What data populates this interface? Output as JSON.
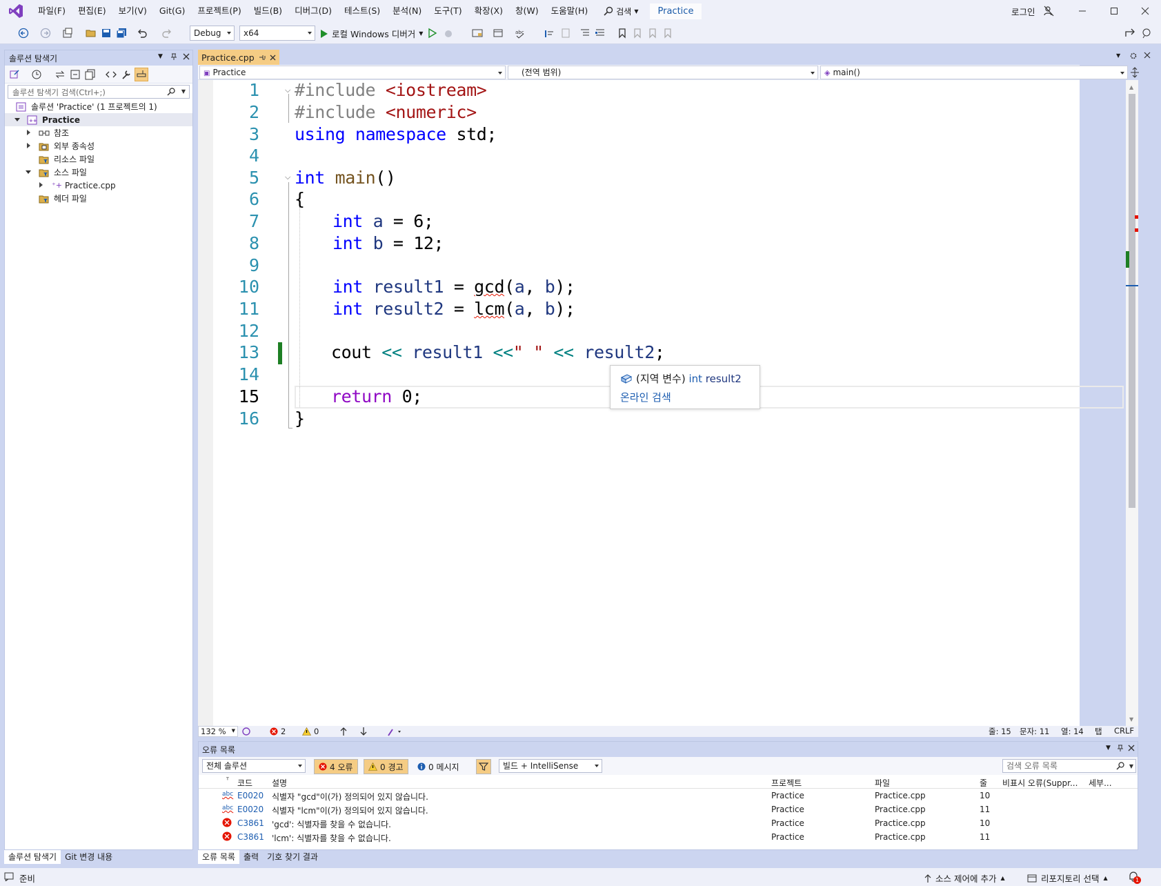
{
  "menu": {
    "items": [
      "파일(F)",
      "편집(E)",
      "보기(V)",
      "Git(G)",
      "프로젝트(P)",
      "빌드(B)",
      "디버그(D)",
      "테스트(S)",
      "분석(N)",
      "도구(T)",
      "확장(X)",
      "창(W)",
      "도움말(H)"
    ],
    "search_label": "검색",
    "solution_name": "Practice",
    "login_label": "로그인"
  },
  "toolbar": {
    "configuration": "Debug",
    "platform": "x64",
    "run_label": "로컬 Windows 디버거"
  },
  "solution_explorer": {
    "title": "솔루션 탐색기",
    "search_placeholder": "솔루션 탐색기 검색(Ctrl+;)",
    "solution_label": "솔루션 'Practice' (1 프로젝트의 1)",
    "project": "Practice",
    "nodes": [
      "참조",
      "외부 종속성",
      "리소스 파일",
      "소스 파일",
      "Practice.cpp",
      "헤더 파일"
    ],
    "bottom_tabs": [
      "솔루션 탐색기",
      "Git 변경 내용"
    ]
  },
  "editor": {
    "tab_title": "Practice.cpp",
    "nav_project": "Practice",
    "nav_scope": "(전역 범위)",
    "nav_member": "main()",
    "line_numbers": [
      "1",
      "2",
      "3",
      "4",
      "5",
      "6",
      "7",
      "8",
      "9",
      "10",
      "11",
      "12",
      "13",
      "14",
      "15",
      "16"
    ],
    "code": {
      "l1_kw": "#include ",
      "l1_str": "<iostream>",
      "l2_kw": "#include ",
      "l2_str": "<numeric>",
      "l3_a": "using ",
      "l3_b": "namespace ",
      "l3_c": "std;",
      "l5_a": "int ",
      "l5_b": "main",
      "l5_c": "()",
      "l6": "{",
      "l7_a": "int ",
      "l7_b": "a",
      "l7_c": " = 6;",
      "l8_a": "int ",
      "l8_b": "b",
      "l8_c": " = 12;",
      "l10_a": "int ",
      "l10_b": "result1",
      "l10_c": " = ",
      "l10_d": "gcd",
      "l10_e": "(",
      "l10_f": "a",
      "l10_g": ", ",
      "l10_h": "b",
      "l10_i": ");",
      "l11_a": "int ",
      "l11_b": "result2",
      "l11_c": " = ",
      "l11_d": "lcm",
      "l11_e": "(",
      "l11_f": "a",
      "l11_g": ", ",
      "l11_h": "b",
      "l11_i": ");",
      "l13_a": "cout ",
      "l13_b": "<<",
      "l13_c": " result1 ",
      "l13_d": "<<",
      "l13_e": "\" \"",
      "l13_f": " ",
      "l13_g": "<<",
      "l13_h": " result2",
      "l13_i": ";",
      "l15_a": "return ",
      "l15_b": "0;",
      "l16": "}"
    },
    "tooltip": {
      "kind": "(지역 변수) ",
      "type": "int",
      "name": " result2",
      "link": "온라인 검색"
    },
    "status": {
      "zoom": "132 %",
      "errors": "2",
      "warnings": "0",
      "line": "줄: 15",
      "char": "문자: 11",
      "col": "열: 14",
      "tab": "탭",
      "eol": "CRLF"
    }
  },
  "error_list": {
    "title": "오류 목록",
    "scope": "전체 솔루션",
    "errors_btn": "4 오류",
    "warnings_btn": "0 경고",
    "messages_btn": "0 메시지",
    "build_filter": "빌드 + IntelliSense",
    "search_placeholder": "검색 오류 목록",
    "columns": [
      "코드",
      "설명",
      "프로젝트",
      "파일",
      "줄",
      "비표시 오류(Suppr...",
      "세부..."
    ],
    "rows": [
      {
        "icon": "abc",
        "code": "E0020",
        "desc": "식별자 \"gcd\"이(가) 정의되어 있지 않습니다.",
        "project": "Practice",
        "file": "Practice.cpp",
        "line": "10"
      },
      {
        "icon": "abc",
        "code": "E0020",
        "desc": "식별자 \"lcm\"이(가) 정의되어 있지 않습니다.",
        "project": "Practice",
        "file": "Practice.cpp",
        "line": "11"
      },
      {
        "icon": "error",
        "code": "C3861",
        "desc": "'gcd': 식별자를 찾을 수 없습니다.",
        "project": "Practice",
        "file": "Practice.cpp",
        "line": "10"
      },
      {
        "icon": "error",
        "code": "C3861",
        "desc": "'lcm': 식별자를 찾을 수 없습니다.",
        "project": "Practice",
        "file": "Practice.cpp",
        "line": "11"
      }
    ],
    "bottom_tabs": [
      "오류 목록",
      "출력",
      "기호 찾기 결과"
    ]
  },
  "statusbar": {
    "ready": "준비",
    "source_control": "소스 제어에 추가",
    "repository": "리포지토리 선택",
    "notifications": "1"
  },
  "colors": {
    "accent": "#f5cc84",
    "error": "#e51400",
    "keyword": "#0000ff",
    "string": "#a31515"
  }
}
